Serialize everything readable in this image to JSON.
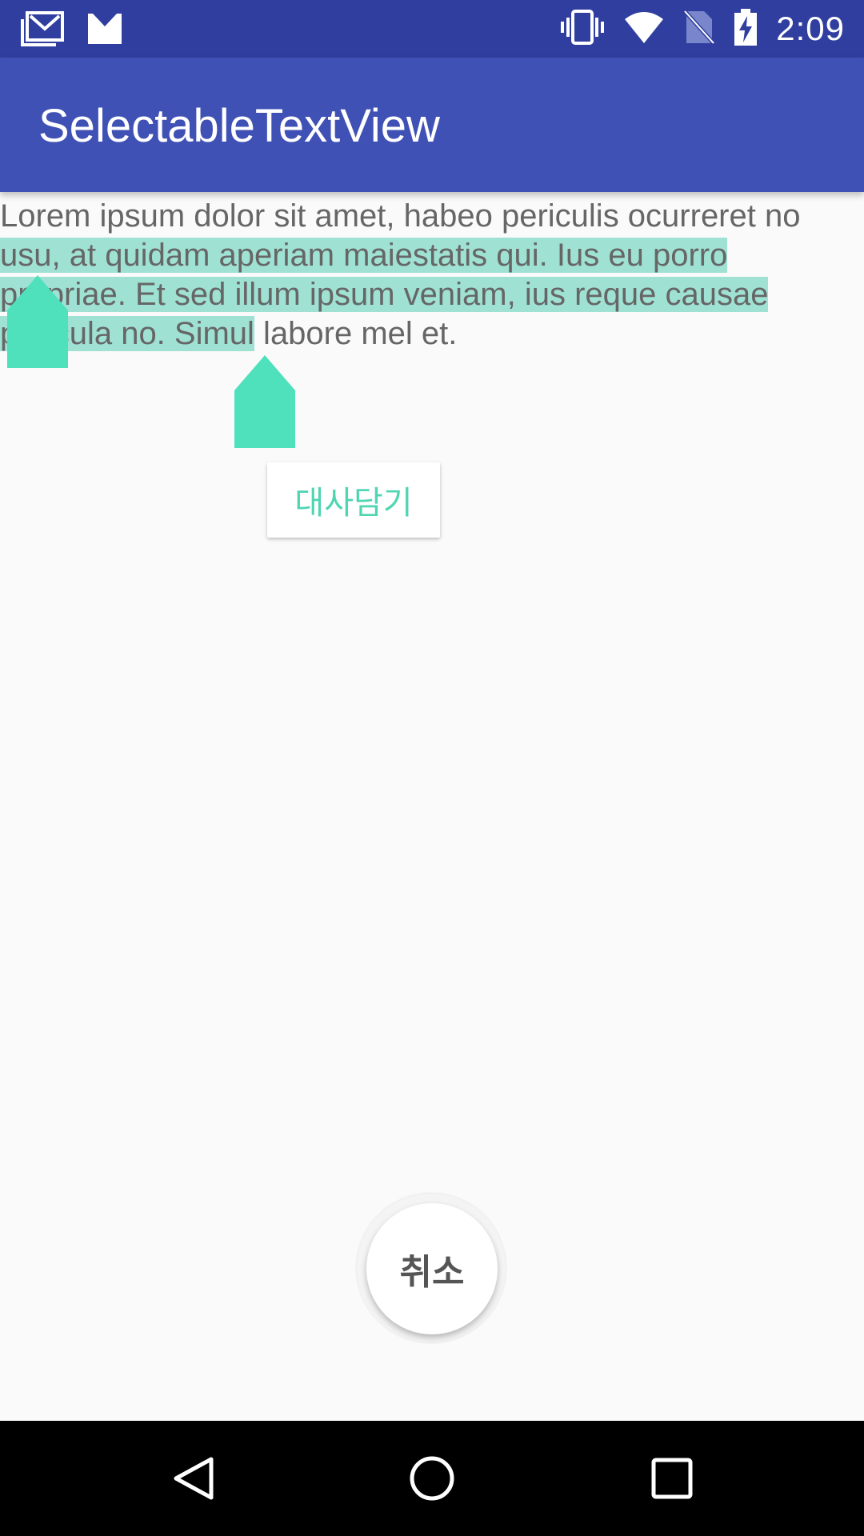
{
  "status_bar": {
    "time": "2:09",
    "left_icons": [
      "gallery-mail-icon",
      "gmail-icon"
    ],
    "right_icons": [
      "vibrate-icon",
      "wifi-icon",
      "no-sim-icon",
      "battery-charging-icon"
    ]
  },
  "app_bar": {
    "title": "SelectableTextView"
  },
  "content": {
    "text_before": "Lorem ipsum dolor sit amet, habeo periculis ocurreret no",
    "text_selected": " usu, at quidam aperiam maiestatis qui. Ius eu porro propriae. Et sed illum ipsum veniam, ius reque causae pericula no. Simul",
    "text_after": " labore mel et."
  },
  "selection_popup": {
    "action_label": "대사담기"
  },
  "cancel_button": {
    "label": "취소"
  },
  "nav_bar": {
    "buttons": [
      "back-icon",
      "home-icon",
      "recents-icon"
    ]
  },
  "colors": {
    "status_bar": "#303f9f",
    "app_bar": "#3f51b5",
    "selection_highlight": "#9fe2d4",
    "accent": "#4fd5b2"
  }
}
